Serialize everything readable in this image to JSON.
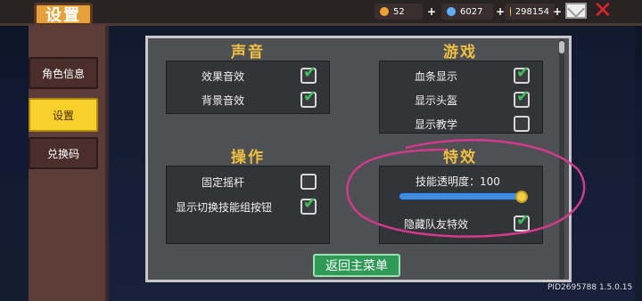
{
  "header": {
    "title": "设置",
    "resources": [
      {
        "value": "52",
        "icon": "energy-icon",
        "color": "#f0a030"
      },
      {
        "value": "6027",
        "icon": "gem-icon",
        "color": "#5ab0ff"
      },
      {
        "value": "298154",
        "icon": "gold-icon",
        "color": "#f5d040"
      }
    ]
  },
  "sidebar": {
    "items": [
      {
        "label": "角色信息",
        "active": false
      },
      {
        "label": "设置",
        "active": true
      },
      {
        "label": "兑换码",
        "active": false
      }
    ]
  },
  "sections": {
    "sound": {
      "title": "声音",
      "options": [
        {
          "label": "效果音效",
          "checked": true
        },
        {
          "label": "背景音效",
          "checked": true
        }
      ]
    },
    "game": {
      "title": "游戏",
      "options": [
        {
          "label": "血条显示",
          "checked": true
        },
        {
          "label": "显示头盔",
          "checked": true
        },
        {
          "label": "显示教学",
          "checked": false
        }
      ]
    },
    "control": {
      "title": "操作",
      "options": [
        {
          "label": "固定摇杆",
          "checked": false
        },
        {
          "label": "显示切换技能组按钮",
          "checked": true
        }
      ]
    },
    "effects": {
      "title": "特效",
      "slider_label": "技能透明度：100",
      "slider_value": 100,
      "options": [
        {
          "label": "隐藏队友特效",
          "checked": true
        }
      ]
    }
  },
  "back_button": "返回主菜单",
  "version": "PID2695788 1.5.0.15",
  "colors": {
    "accent_title": "#f0c040",
    "check": "#3fbf5a",
    "active_tab": "#f7d02a",
    "annotation": "#d23a8c"
  }
}
